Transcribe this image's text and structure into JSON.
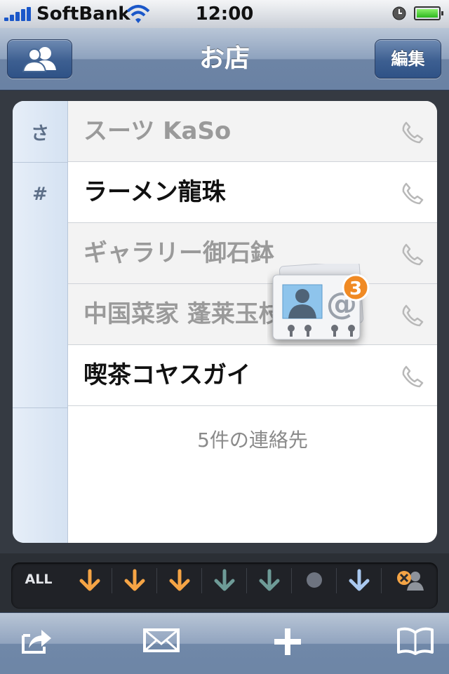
{
  "status_bar": {
    "carrier": "SoftBank",
    "time": "12:00",
    "signal_icon": "signal-bars-icon",
    "wifi_icon": "wifi-icon",
    "alarm_icon": "alarm-clock-icon",
    "battery_icon": "battery-full-icon"
  },
  "nav": {
    "title": "お店",
    "left_icon": "groups-icon",
    "edit_label": "編集"
  },
  "index": [
    "さ",
    "#"
  ],
  "contacts": [
    {
      "name": "スーツ KaSo",
      "style": "grey"
    },
    {
      "name": "ラーメン龍珠",
      "style": "white"
    },
    {
      "name": "ギャラリー御石鉢",
      "style": "grey"
    },
    {
      "name": "中国菜家 蓬莱玉枝",
      "style": "grey"
    },
    {
      "name": "喫茶コヤスガイ",
      "style": "white"
    }
  ],
  "contact_count": "5件の連絡先",
  "drag_badge": "3",
  "filter": {
    "all_label": "ALL",
    "colors": {
      "orange": "#f5a445",
      "teal": "#6e9b97",
      "blue": "#a9c8ef",
      "dot": "#6e7480"
    }
  },
  "toolbar": {
    "share_icon": "share-icon",
    "mail_icon": "mail-icon",
    "add_icon": "plus-icon",
    "bookmarks_icon": "book-icon"
  }
}
